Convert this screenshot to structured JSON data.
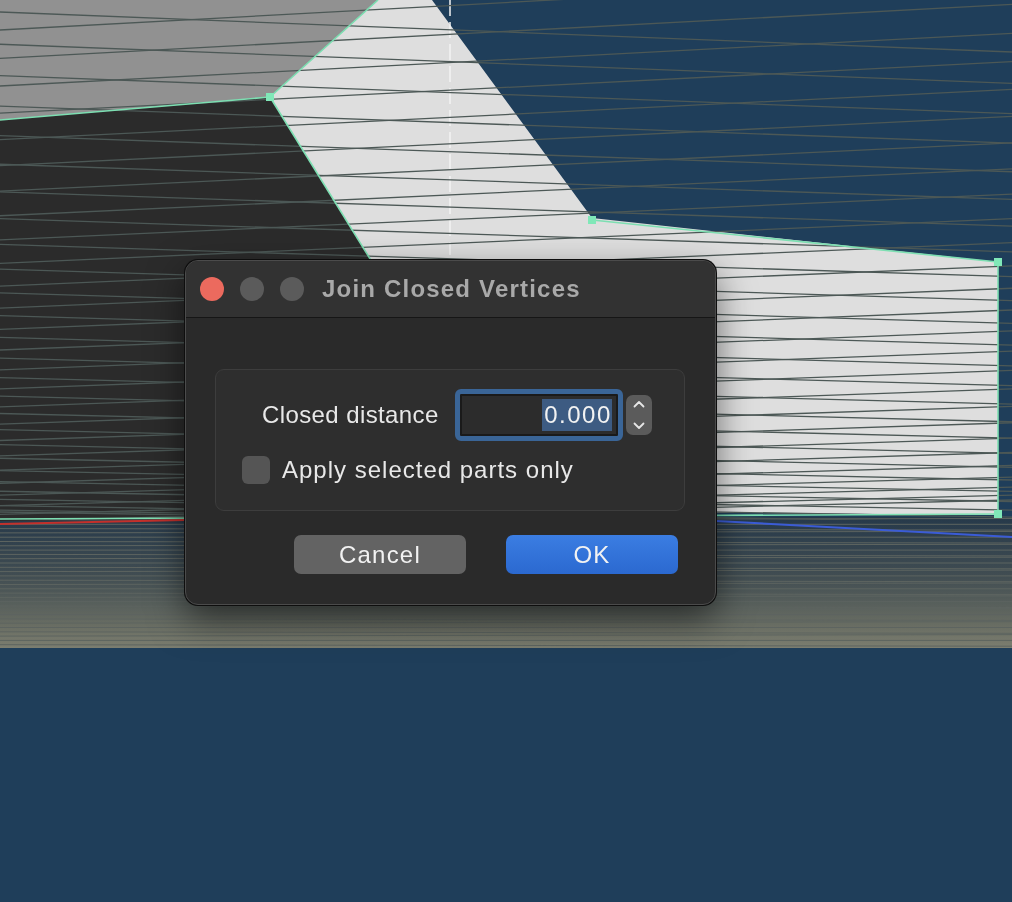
{
  "dialog": {
    "title": "Join Closed Vertices",
    "window_buttons": [
      {
        "kind": "close",
        "disabled": false
      },
      {
        "kind": "minimize",
        "disabled": true
      },
      {
        "kind": "zoom",
        "disabled": true
      }
    ],
    "fields": [
      {
        "label": "Closed distance",
        "value": "0.000",
        "focused": true,
        "value_selected": true
      }
    ],
    "checkbox": {
      "label": "Apply selected parts only",
      "checked": false
    },
    "buttons": [
      {
        "label": "Cancel",
        "default": false
      },
      {
        "label": "OK",
        "default": true
      }
    ]
  }
}
